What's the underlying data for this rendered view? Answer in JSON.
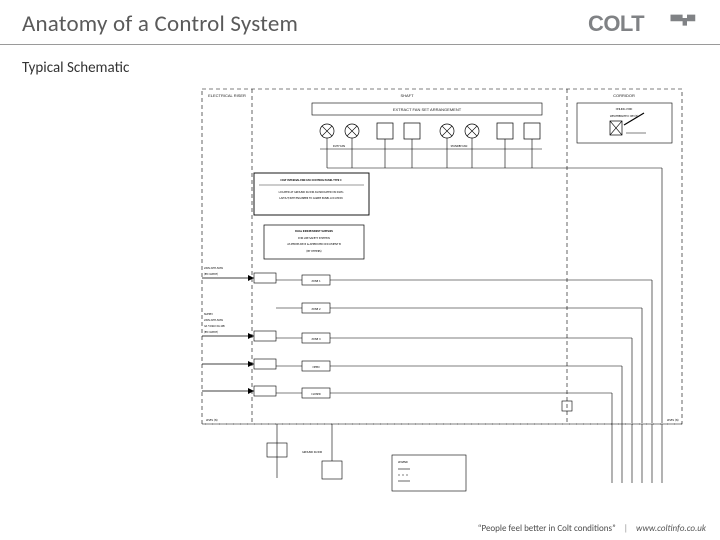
{
  "header": {
    "title": "Anatomy of a Control System",
    "logo_text": "COLT"
  },
  "subtitle": "Typical Schematic",
  "footer": {
    "tagline": "“People feel better in Colt conditions”",
    "url": "www.coltinfo.co.uk"
  },
  "schematic": {
    "top_sections": [
      "ELECTRICAL RISER",
      "SHAFT",
      "CORRIDOR"
    ],
    "shaft_header": "EXTRACT FAN SET ARRANGEMENT",
    "corridor_header": "CEILING VOID",
    "corridor_sub": "WEATHERLITE II OPV(S)",
    "control_box": {
      "title": "COLT INTERNAL FIRE FAN CONTROL PANEL TYPE C",
      "line1": "LOCATED AT GROUND FLOOR AS INDICATED ON DWG",
      "line2": "LAYOUT/SITE ENGINEER TO AGREE PANEL LOCATION"
    },
    "supply_box": {
      "title": "DUAL INDEPENDENT SUPPLIES",
      "line1": "FOR LIFE SAFETY SYSTEMS",
      "line2": "AS PER BS 8519 & APPROVED DOCUMENT B",
      "line3": "(BY OTHERS)"
    },
    "left_labels": [
      "230V-1PH-50Hz",
      "(BY CLIENT)",
      "SUPPLY",
      "230V-1PH-50Hz",
      "3A +230V-50-1Ph",
      "(BY CLIENT)",
      "LEVEL (N)"
    ],
    "mid_labels": [
      "ZONE 1",
      "ZONE 2",
      "ZONE 3",
      "OPEN",
      "CLOSED",
      "GROUND FLOOR",
      "DUTY FAN",
      "STANDBY FAN"
    ],
    "bottom_right": "LEVEL (N)",
    "legend_box": "LEGEND"
  }
}
